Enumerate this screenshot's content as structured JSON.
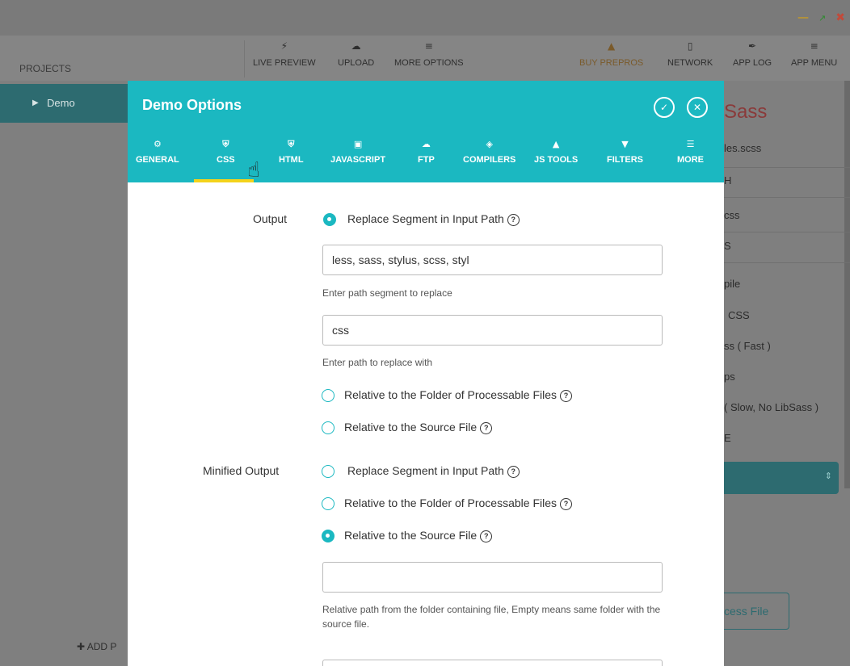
{
  "window": {
    "min_icon": "minimize-icon",
    "max_icon": "maximize-icon",
    "close_icon": "close-icon"
  },
  "sidebar": {
    "projects_label": "PROJECTS",
    "project_name": "Demo",
    "add_project": "ADD P"
  },
  "toolbar": {
    "live_preview": "LIVE PREVIEW",
    "upload": "UPLOAD",
    "more_options": "MORE OPTIONS",
    "buy_prepros": "BUY PREPROS",
    "network": "NETWORK",
    "app_log": "APP LOG",
    "app_menu": "APP MENU"
  },
  "background": {
    "title_partial": "Sass",
    "file_partial": "les.scss",
    "row1": "H",
    "row2": "css",
    "row3": "S",
    "opt1": "pile",
    "opt2": "CSS",
    "opt3": "ss ( Fast )",
    "opt4": "ps",
    "opt5": "( Slow, No LibSass )",
    "opt6": "E",
    "process_partial": "cess File"
  },
  "modal": {
    "title": "Demo Options",
    "tabs": [
      {
        "label": "GENERAL",
        "icon": "gear-icon"
      },
      {
        "label": "CSS",
        "icon": "css3-icon"
      },
      {
        "label": "HTML",
        "icon": "html5-icon"
      },
      {
        "label": "JAVASCRIPT",
        "icon": "image-icon"
      },
      {
        "label": "FTP",
        "icon": "cloud-upload-icon"
      },
      {
        "label": "COMPILERS",
        "icon": "layers-icon"
      },
      {
        "label": "JS TOOLS",
        "icon": "fire-icon"
      },
      {
        "label": "FILTERS",
        "icon": "filter-icon"
      },
      {
        "label": "MORE",
        "icon": "list-icon"
      }
    ],
    "active_tab": "CSS"
  },
  "form": {
    "output_label": "Output",
    "output_opt_replace": "Replace Segment in Input Path",
    "output_segment_value": "less, sass, stylus, scss, styl",
    "output_segment_hint": "Enter path segment to replace",
    "output_replace_value": "css",
    "output_replace_hint": "Enter path to replace with",
    "output_opt_folder": "Relative to the Folder of Processable Files",
    "output_opt_source": "Relative to the Source File",
    "output_selected": "Replace Segment in Input Path",
    "minified_label": "Minified Output",
    "min_opt_replace": "Replace Segment in Input Path",
    "min_opt_folder": "Relative to the Folder of Processable Files",
    "min_opt_source": "Relative to the Source File",
    "min_selected": "Relative to the Source File",
    "min_path_value": "",
    "min_path_hint": "Relative path from the folder containing file, Empty means same folder with the source file."
  },
  "colors": {
    "accent": "#1bb8c1",
    "tab_underline": "#f4d31b",
    "project_active": "#2d6b70",
    "overlay": "#7f7f7f"
  }
}
